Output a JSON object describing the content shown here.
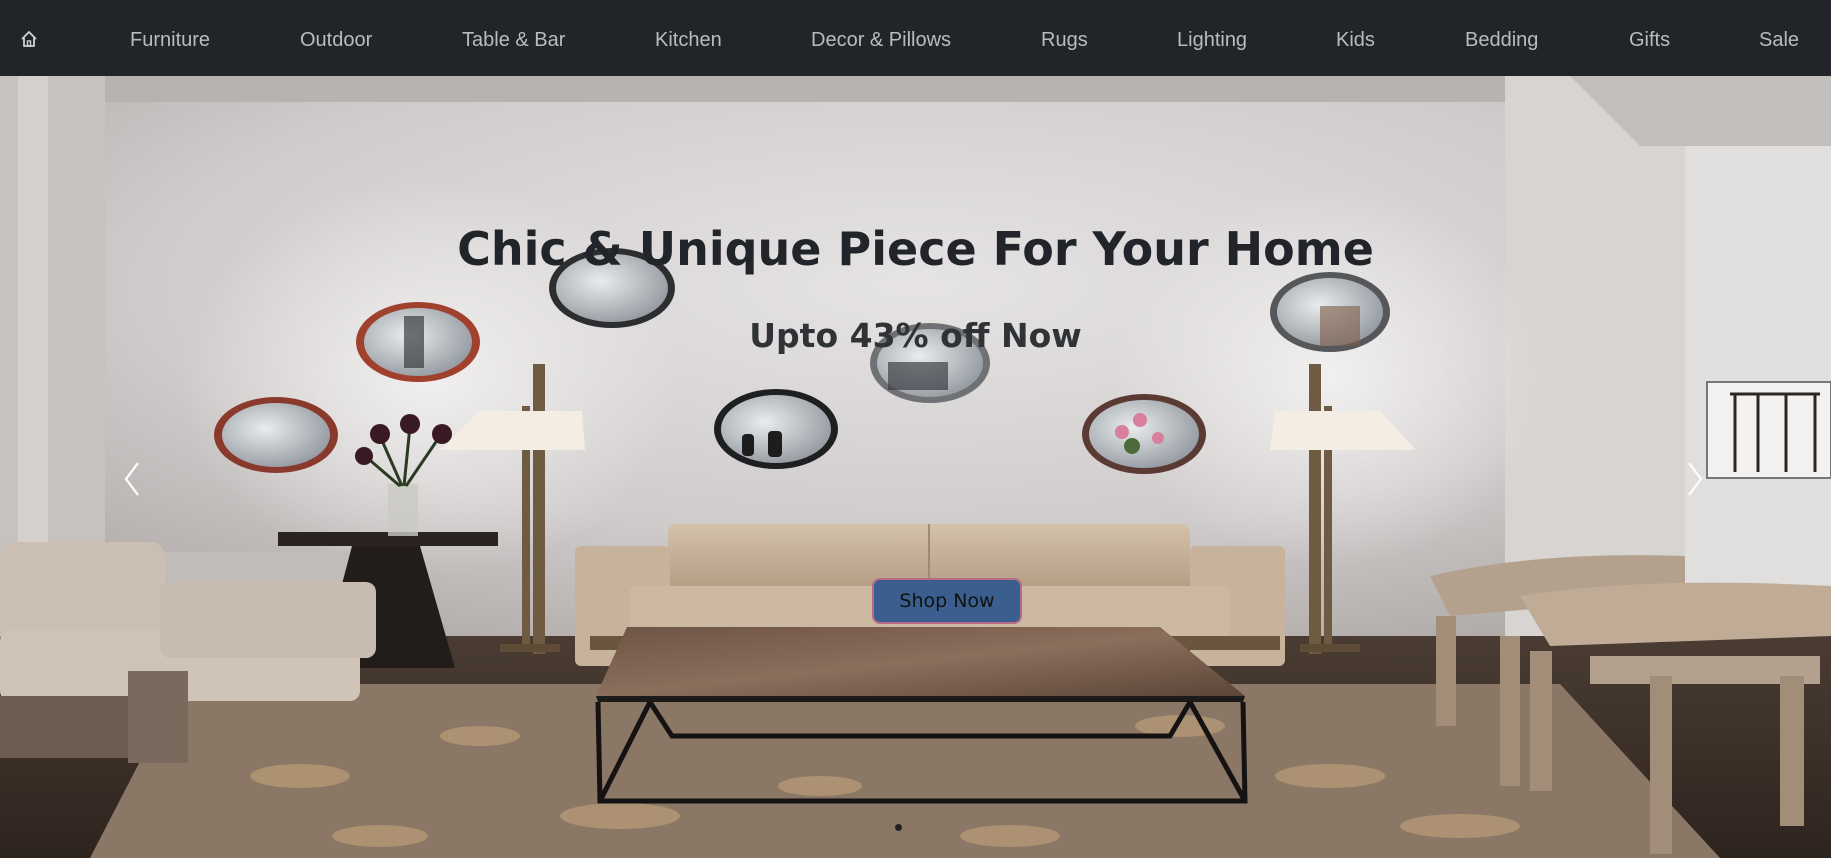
{
  "nav": {
    "home_icon": "home-icon",
    "items": [
      {
        "label": "Furniture"
      },
      {
        "label": "Outdoor"
      },
      {
        "label": "Table & Bar"
      },
      {
        "label": "Kitchen"
      },
      {
        "label": "Decor & Pillows"
      },
      {
        "label": "Rugs"
      },
      {
        "label": "Lighting"
      },
      {
        "label": "Kids"
      },
      {
        "label": "Bedding"
      },
      {
        "label": "Gifts"
      },
      {
        "label": "Sale"
      }
    ]
  },
  "hero": {
    "title": "Chic & Unique Piece For Your Home",
    "subtitle": "Upto 43% off Now",
    "cta_label": "Shop Now",
    "prev_icon": "chevron-left-icon",
    "next_icon": "chevron-right-icon",
    "slide_count": 1,
    "active_slide": 1
  },
  "colors": {
    "navbar_bg": "#212529",
    "nav_text": "#b9bcbf",
    "cta_bg": "#3a5f8e",
    "cta_border": "#b96b86",
    "headline": "#212529"
  }
}
